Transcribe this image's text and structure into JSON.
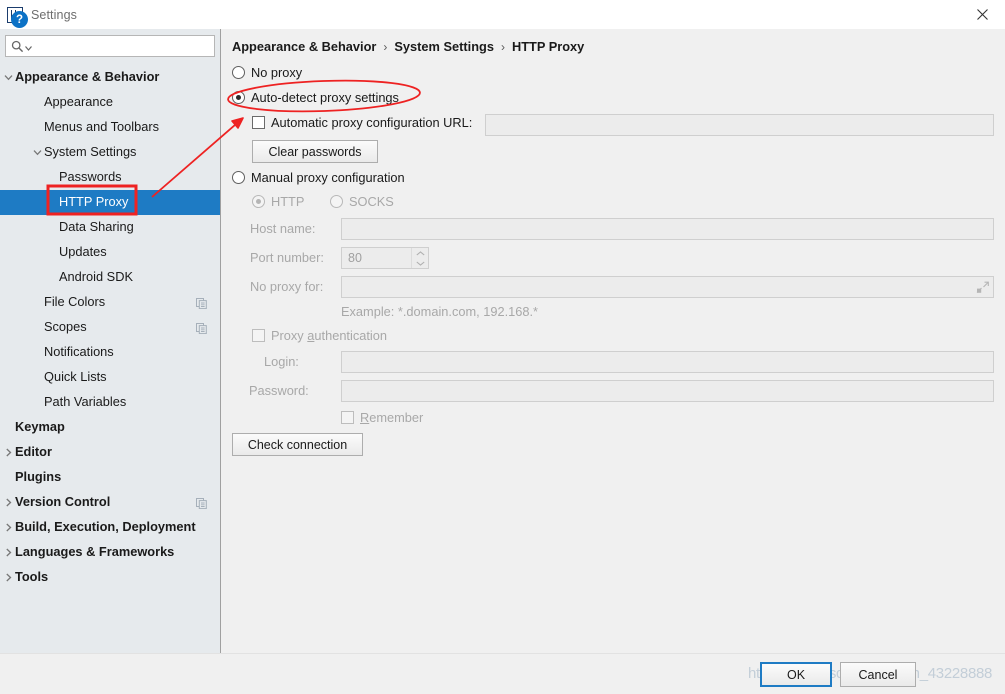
{
  "window": {
    "title": "Settings",
    "app_icon": "intellij-idea-icon",
    "close_icon": "close-icon"
  },
  "sidebar": {
    "search": {
      "placeholder": "",
      "value": "",
      "icon": "search-icon",
      "caret_icon": "chevron-down-icon"
    },
    "items": [
      {
        "label": "Appearance & Behavior",
        "level": 0,
        "bold": true,
        "arrow": "expanded",
        "selected": false,
        "copy_icon": false
      },
      {
        "label": "Appearance",
        "level": 1,
        "bold": false,
        "arrow": "none",
        "selected": false,
        "copy_icon": false
      },
      {
        "label": "Menus and Toolbars",
        "level": 1,
        "bold": false,
        "arrow": "none",
        "selected": false,
        "copy_icon": false
      },
      {
        "label": "System Settings",
        "level": 1,
        "bold": false,
        "arrow": "expanded",
        "selected": false,
        "copy_icon": false
      },
      {
        "label": "Passwords",
        "level": 2,
        "bold": false,
        "arrow": "none",
        "selected": false,
        "copy_icon": false
      },
      {
        "label": "HTTP Proxy",
        "level": 2,
        "bold": false,
        "arrow": "none",
        "selected": true,
        "copy_icon": false
      },
      {
        "label": "Data Sharing",
        "level": 2,
        "bold": false,
        "arrow": "none",
        "selected": false,
        "copy_icon": false
      },
      {
        "label": "Updates",
        "level": 2,
        "bold": false,
        "arrow": "none",
        "selected": false,
        "copy_icon": false
      },
      {
        "label": "Android SDK",
        "level": 2,
        "bold": false,
        "arrow": "none",
        "selected": false,
        "copy_icon": false
      },
      {
        "label": "File Colors",
        "level": 1,
        "bold": false,
        "arrow": "none",
        "selected": false,
        "copy_icon": true
      },
      {
        "label": "Scopes",
        "level": 1,
        "bold": false,
        "arrow": "none",
        "selected": false,
        "copy_icon": true
      },
      {
        "label": "Notifications",
        "level": 1,
        "bold": false,
        "arrow": "none",
        "selected": false,
        "copy_icon": false
      },
      {
        "label": "Quick Lists",
        "level": 1,
        "bold": false,
        "arrow": "none",
        "selected": false,
        "copy_icon": false
      },
      {
        "label": "Path Variables",
        "level": 1,
        "bold": false,
        "arrow": "none",
        "selected": false,
        "copy_icon": false
      },
      {
        "label": "Keymap",
        "level": 0,
        "bold": true,
        "arrow": "none",
        "selected": false,
        "copy_icon": false
      },
      {
        "label": "Editor",
        "level": 0,
        "bold": true,
        "arrow": "collapsed",
        "selected": false,
        "copy_icon": false
      },
      {
        "label": "Plugins",
        "level": 0,
        "bold": true,
        "arrow": "none",
        "selected": false,
        "copy_icon": false
      },
      {
        "label": "Version Control",
        "level": 0,
        "bold": true,
        "arrow": "collapsed",
        "selected": false,
        "copy_icon": true
      },
      {
        "label": "Build, Execution, Deployment",
        "level": 0,
        "bold": true,
        "arrow": "collapsed",
        "selected": false,
        "copy_icon": false
      },
      {
        "label": "Languages & Frameworks",
        "level": 0,
        "bold": true,
        "arrow": "collapsed",
        "selected": false,
        "copy_icon": false
      },
      {
        "label": "Tools",
        "level": 0,
        "bold": true,
        "arrow": "collapsed",
        "selected": false,
        "copy_icon": false
      }
    ]
  },
  "main": {
    "breadcrumb": {
      "crumb1": "Appearance & Behavior",
      "crumb2": "System Settings",
      "crumb3": "HTTP Proxy",
      "separator": "›"
    },
    "no_proxy_label": "No proxy",
    "auto_detect_label": "Auto-detect proxy settings",
    "auto_config_url_label": "Automatic proxy configuration URL:",
    "auto_config_url_value": "",
    "clear_passwords_label": "Clear passwords",
    "manual_label": "Manual proxy configuration",
    "http_label": "HTTP",
    "socks_label": "SOCKS",
    "host_name_label": "Host name:",
    "host_name_value": "",
    "port_number_label": "Port number:",
    "port_number_value": "80",
    "no_proxy_for_label": "No proxy for:",
    "no_proxy_for_value": "",
    "example_text": "Example: *.domain.com, 192.168.*",
    "proxy_auth_label_pre": "Proxy ",
    "proxy_auth_label_mnemonic": "a",
    "proxy_auth_label_post": "uthentication",
    "login_label": "Login:",
    "login_value": "",
    "password_label": "Password:",
    "password_value": "",
    "remember_label_mnemonic": "R",
    "remember_label_post": "emember",
    "check_connection_label": "Check connection",
    "expand_icon": "expand-icon",
    "spinner_up_icon": "chevron-up-icon",
    "spinner_down_icon": "chevron-down-icon",
    "selected_proxy_mode": "auto-detect",
    "selected_manual_protocol": "HTTP"
  },
  "bottom": {
    "help_icon": "help-icon",
    "help_glyph": "?",
    "ok_label": "OK",
    "cancel_label": "Cancel",
    "watermark": "https://blog.csdn.net/weixin_43228888"
  },
  "annotations": {
    "accent_color": "#ee2222",
    "highlight_color": "#1e7bc4",
    "ellipse_target": "auto-detect proxy settings",
    "rect_target": "HTTP Proxy",
    "arrow_from": "HTTP Proxy",
    "arrow_to": "auto-detect proxy settings"
  }
}
